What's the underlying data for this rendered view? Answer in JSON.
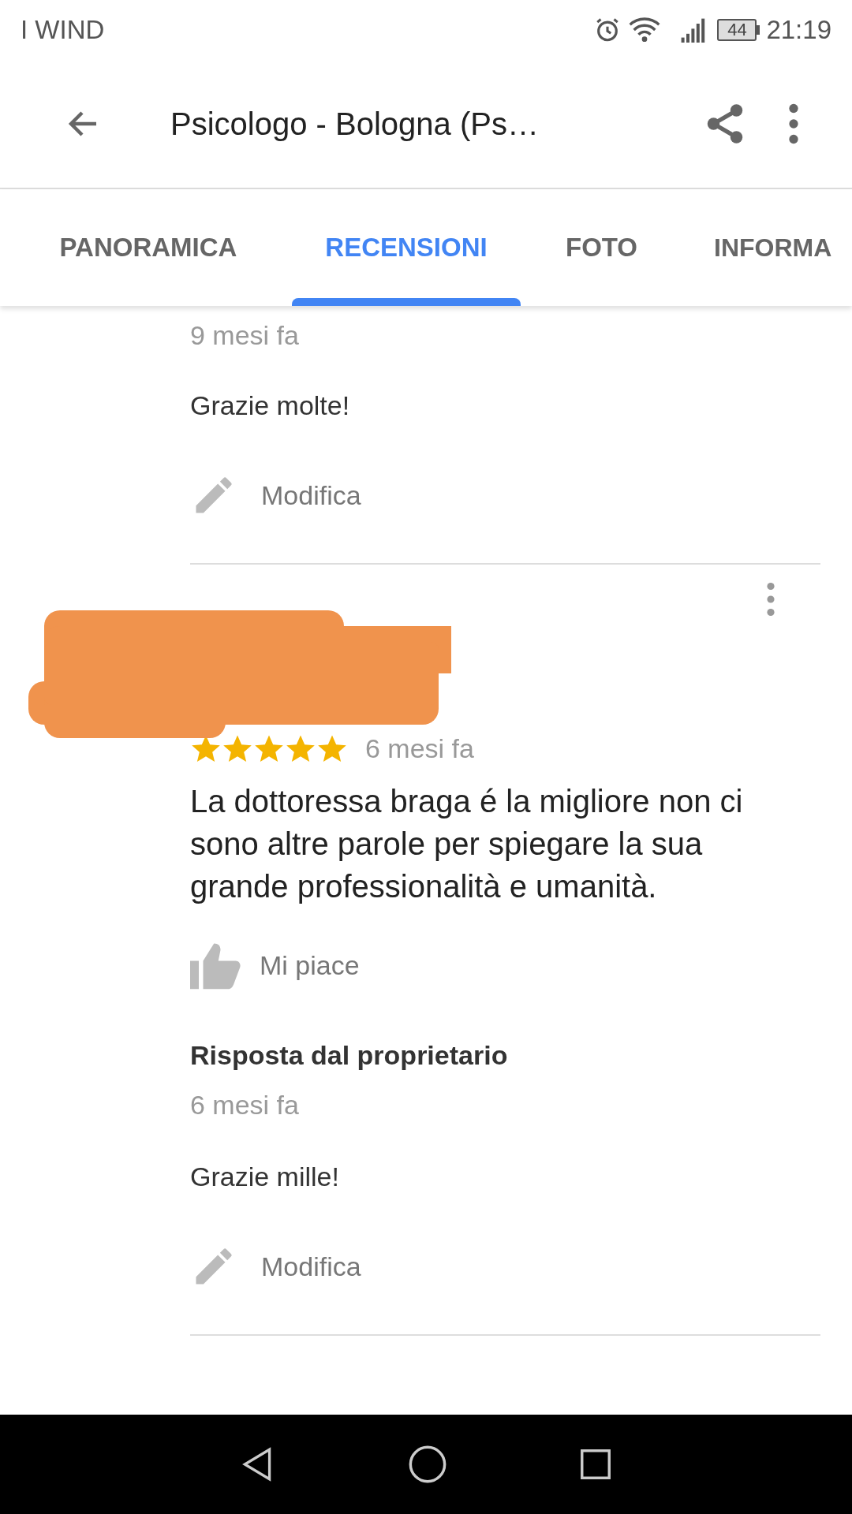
{
  "status_bar": {
    "carrier": "I WIND",
    "battery": "44",
    "time": "21:19"
  },
  "app_bar": {
    "title": "Psicologo - Bologna (Ps…"
  },
  "tabs": [
    {
      "label": "PANORAMICA",
      "selected": false
    },
    {
      "label": "RECENSIONI",
      "selected": true
    },
    {
      "label": "FOTO",
      "selected": false
    },
    {
      "label": "INFORMA",
      "selected": false
    }
  ],
  "top_reply": {
    "time": "9 mesi fa",
    "text": "Grazie molte!",
    "edit": "Modifica"
  },
  "review": {
    "stars": 5,
    "time": "6 mesi fa",
    "text": "La dottoressa braga é la migliore non ci sono altre parole per spiegare la sua grande professionalità e umanità.",
    "like": "Mi piace",
    "reply": {
      "heading": "Risposta dal proprietario",
      "time": "6 mesi fa",
      "text": "Grazie mille!",
      "edit": "Modifica"
    }
  }
}
